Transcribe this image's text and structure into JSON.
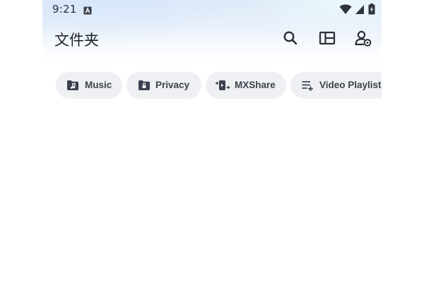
{
  "status_bar": {
    "time": "9:21",
    "notification_icon": "a-box-icon",
    "icons": [
      "wifi-icon",
      "signal-icon",
      "battery-charging-icon"
    ]
  },
  "app_bar": {
    "title": "文件夹",
    "actions": [
      "search-icon",
      "layout-icon",
      "user-settings-icon"
    ]
  },
  "chips": [
    {
      "label": "Music",
      "icon": "music-folder-icon"
    },
    {
      "label": "Privacy",
      "icon": "lock-folder-icon"
    },
    {
      "label": "MXShare",
      "icon": "share-transfer-icon"
    },
    {
      "label": "Video Playlist",
      "icon": "playlist-add-icon"
    }
  ],
  "colors": {
    "chip_background": "#eef0f3",
    "chip_text": "#3c414b",
    "icon": "#3b4150",
    "title": "#1d2128"
  }
}
